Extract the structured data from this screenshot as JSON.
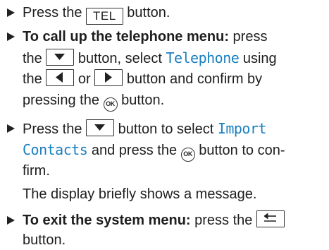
{
  "steps": [
    {
      "text_a": "Press the ",
      "key": "TEL",
      "text_b": " button."
    },
    {
      "lead": "To call up the telephone menu:",
      "text_a": " press",
      "text_b": "the ",
      "text_c": " button, select ",
      "item": "Telephone",
      "text_d": " using",
      "text_e": "the ",
      "text_f": " or ",
      "text_g": " button and confirm by",
      "text_h": "pressing the ",
      "text_i": " button."
    },
    {
      "text_a": "Press the ",
      "text_b": " button to select ",
      "item_a": "Import",
      "item_b": "Contacts",
      "text_c": " and press the ",
      "text_d": " button to con-",
      "text_e": "firm.",
      "note": "The display briefly shows a message."
    },
    {
      "lead": "To exit the system menu:",
      "text_a": " press the ",
      "text_b": "button."
    }
  ],
  "icons": {
    "ok": "OK",
    "down": "down-arrow-key",
    "left": "left-arrow-key",
    "right": "right-arrow-key",
    "back": "back-key",
    "bullet": "triangle-bullet"
  },
  "colors": {
    "menu_item": "#1a7fbf",
    "text": "#1e1e1e"
  }
}
